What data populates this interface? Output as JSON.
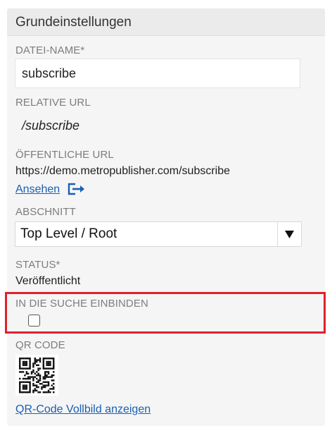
{
  "panel": {
    "title": "Grundeinstellungen"
  },
  "fields": {
    "filename": {
      "label": "DATEI-NAME*",
      "value": "subscribe"
    },
    "relative_url": {
      "label": "RELATIVE URL",
      "value": "/subscribe"
    },
    "public_url": {
      "label": "ÖFFENTLICHE URL",
      "value": "https://demo.metropublisher.com/subscribe",
      "view_link": "Ansehen",
      "view_icon": "external-link-icon"
    },
    "section": {
      "label": "ABSCHNITT",
      "selected": "Top Level / Root",
      "arrow_icon": "caret-down-icon"
    },
    "status": {
      "label": "STATUS*",
      "value": "Veröffentlicht"
    },
    "search": {
      "label": "IN DIE SUCHE EINBINDEN",
      "checked": false
    },
    "qr": {
      "label": "QR CODE",
      "fullscreen_link": "QR-Code Vollbild anzeigen"
    }
  },
  "colors": {
    "link": "#1a5fb4",
    "highlight": "#e0212d",
    "label": "#7d7d7d"
  }
}
